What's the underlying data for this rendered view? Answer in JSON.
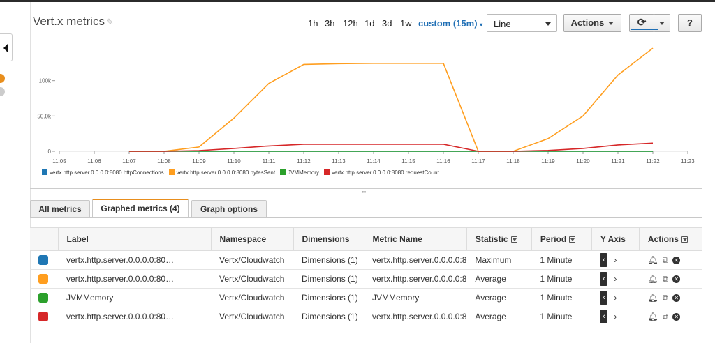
{
  "header": {
    "title": "Vert.x metrics",
    "ranges": [
      "1h",
      "3h",
      "12h",
      "1d",
      "3d",
      "1w"
    ],
    "custom_range": "custom (15m)",
    "view_select": "Line",
    "actions_label": "Actions"
  },
  "icons": {
    "edit": "pencil-icon",
    "refresh": "refresh-icon",
    "help": "help-icon",
    "grip": "resize-grip-icon"
  },
  "chart_data": {
    "type": "line",
    "x": [
      "11:05",
      "11:06",
      "11:07",
      "11:08",
      "11:09",
      "11:10",
      "11:11",
      "11:12",
      "11:13",
      "11:14",
      "11:15",
      "11:16",
      "11:17",
      "11:18",
      "11:19",
      "11:20",
      "11:21",
      "11:22",
      "11:23"
    ],
    "ylim": [
      0,
      150000
    ],
    "yticks": [
      "0",
      "50.0k",
      "100k"
    ],
    "series": [
      {
        "name": "vertx.http.server.0.0.0.0:8080.httpConnections",
        "color": "#1f77b4",
        "points": [
          [
            "11:07",
            0
          ],
          [
            "11:22",
            0
          ]
        ]
      },
      {
        "name": "vertx.http.server.0.0.0.0:8080.bytesSent",
        "color": "#ff9e1f",
        "points": [
          [
            "11:07",
            0
          ],
          [
            "11:08",
            0
          ],
          [
            "11:09",
            6000
          ],
          [
            "11:10",
            47000
          ],
          [
            "11:11",
            96000
          ],
          [
            "11:12",
            123000
          ],
          [
            "11:13",
            124000
          ],
          [
            "11:14",
            124500
          ],
          [
            "11:15",
            124500
          ],
          [
            "11:16",
            124500
          ],
          [
            "11:17",
            0
          ],
          [
            "11:18",
            0
          ],
          [
            "11:19",
            18000
          ],
          [
            "11:20",
            50000
          ],
          [
            "11:21",
            108000
          ],
          [
            "11:22",
            146000
          ]
        ]
      },
      {
        "name": "JVMMemory",
        "color": "#2ca02c",
        "points": [
          [
            "11:07",
            0
          ],
          [
            "11:22",
            0
          ]
        ]
      },
      {
        "name": "vertx.http.server.0.0.0.0:8080.requestCount",
        "color": "#d62728",
        "points": [
          [
            "11:07",
            0
          ],
          [
            "11:08",
            0
          ],
          [
            "11:09",
            1000
          ],
          [
            "11:10",
            4000
          ],
          [
            "11:11",
            7500
          ],
          [
            "11:12",
            10000
          ],
          [
            "11:13",
            10000
          ],
          [
            "11:14",
            10000
          ],
          [
            "11:15",
            10000
          ],
          [
            "11:16",
            10000
          ],
          [
            "11:17",
            0
          ],
          [
            "11:18",
            0
          ],
          [
            "11:19",
            1200
          ],
          [
            "11:20",
            4000
          ],
          [
            "11:21",
            9000
          ],
          [
            "11:22",
            11500
          ]
        ]
      }
    ]
  },
  "tabs": [
    "All metrics",
    "Graphed metrics (4)",
    "Graph options"
  ],
  "table": {
    "headers": [
      "",
      "Label",
      "Namespace",
      "Dimensions",
      "Metric Name",
      "Statistic",
      "Period",
      "Y Axis",
      "Actions"
    ],
    "rows": [
      {
        "color": "#1f77b4",
        "label": "vertx.http.server.0.0.0.0:80…",
        "namespace": "Vertx/Cloudwatch",
        "dimensions": "Dimensions (1)",
        "metric": "vertx.http.server.0.0.0.0:8",
        "statistic": "Maximum",
        "period": "1 Minute"
      },
      {
        "color": "#ff9e1f",
        "label": "vertx.http.server.0.0.0.0:80…",
        "namespace": "Vertx/Cloudwatch",
        "dimensions": "Dimensions (1)",
        "metric": "vertx.http.server.0.0.0.0:8",
        "statistic": "Average",
        "period": "1 Minute"
      },
      {
        "color": "#2ca02c",
        "label": "JVMMemory",
        "namespace": "Vertx/Cloudwatch",
        "dimensions": "Dimensions (1)",
        "metric": "JVMMemory",
        "statistic": "Average",
        "period": "1 Minute"
      },
      {
        "color": "#d62728",
        "label": "vertx.http.server.0.0.0.0:80…",
        "namespace": "Vertx/Cloudwatch",
        "dimensions": "Dimensions (1)",
        "metric": "vertx.http.server.0.0.0.0:8",
        "statistic": "Average",
        "period": "1 Minute"
      }
    ]
  }
}
